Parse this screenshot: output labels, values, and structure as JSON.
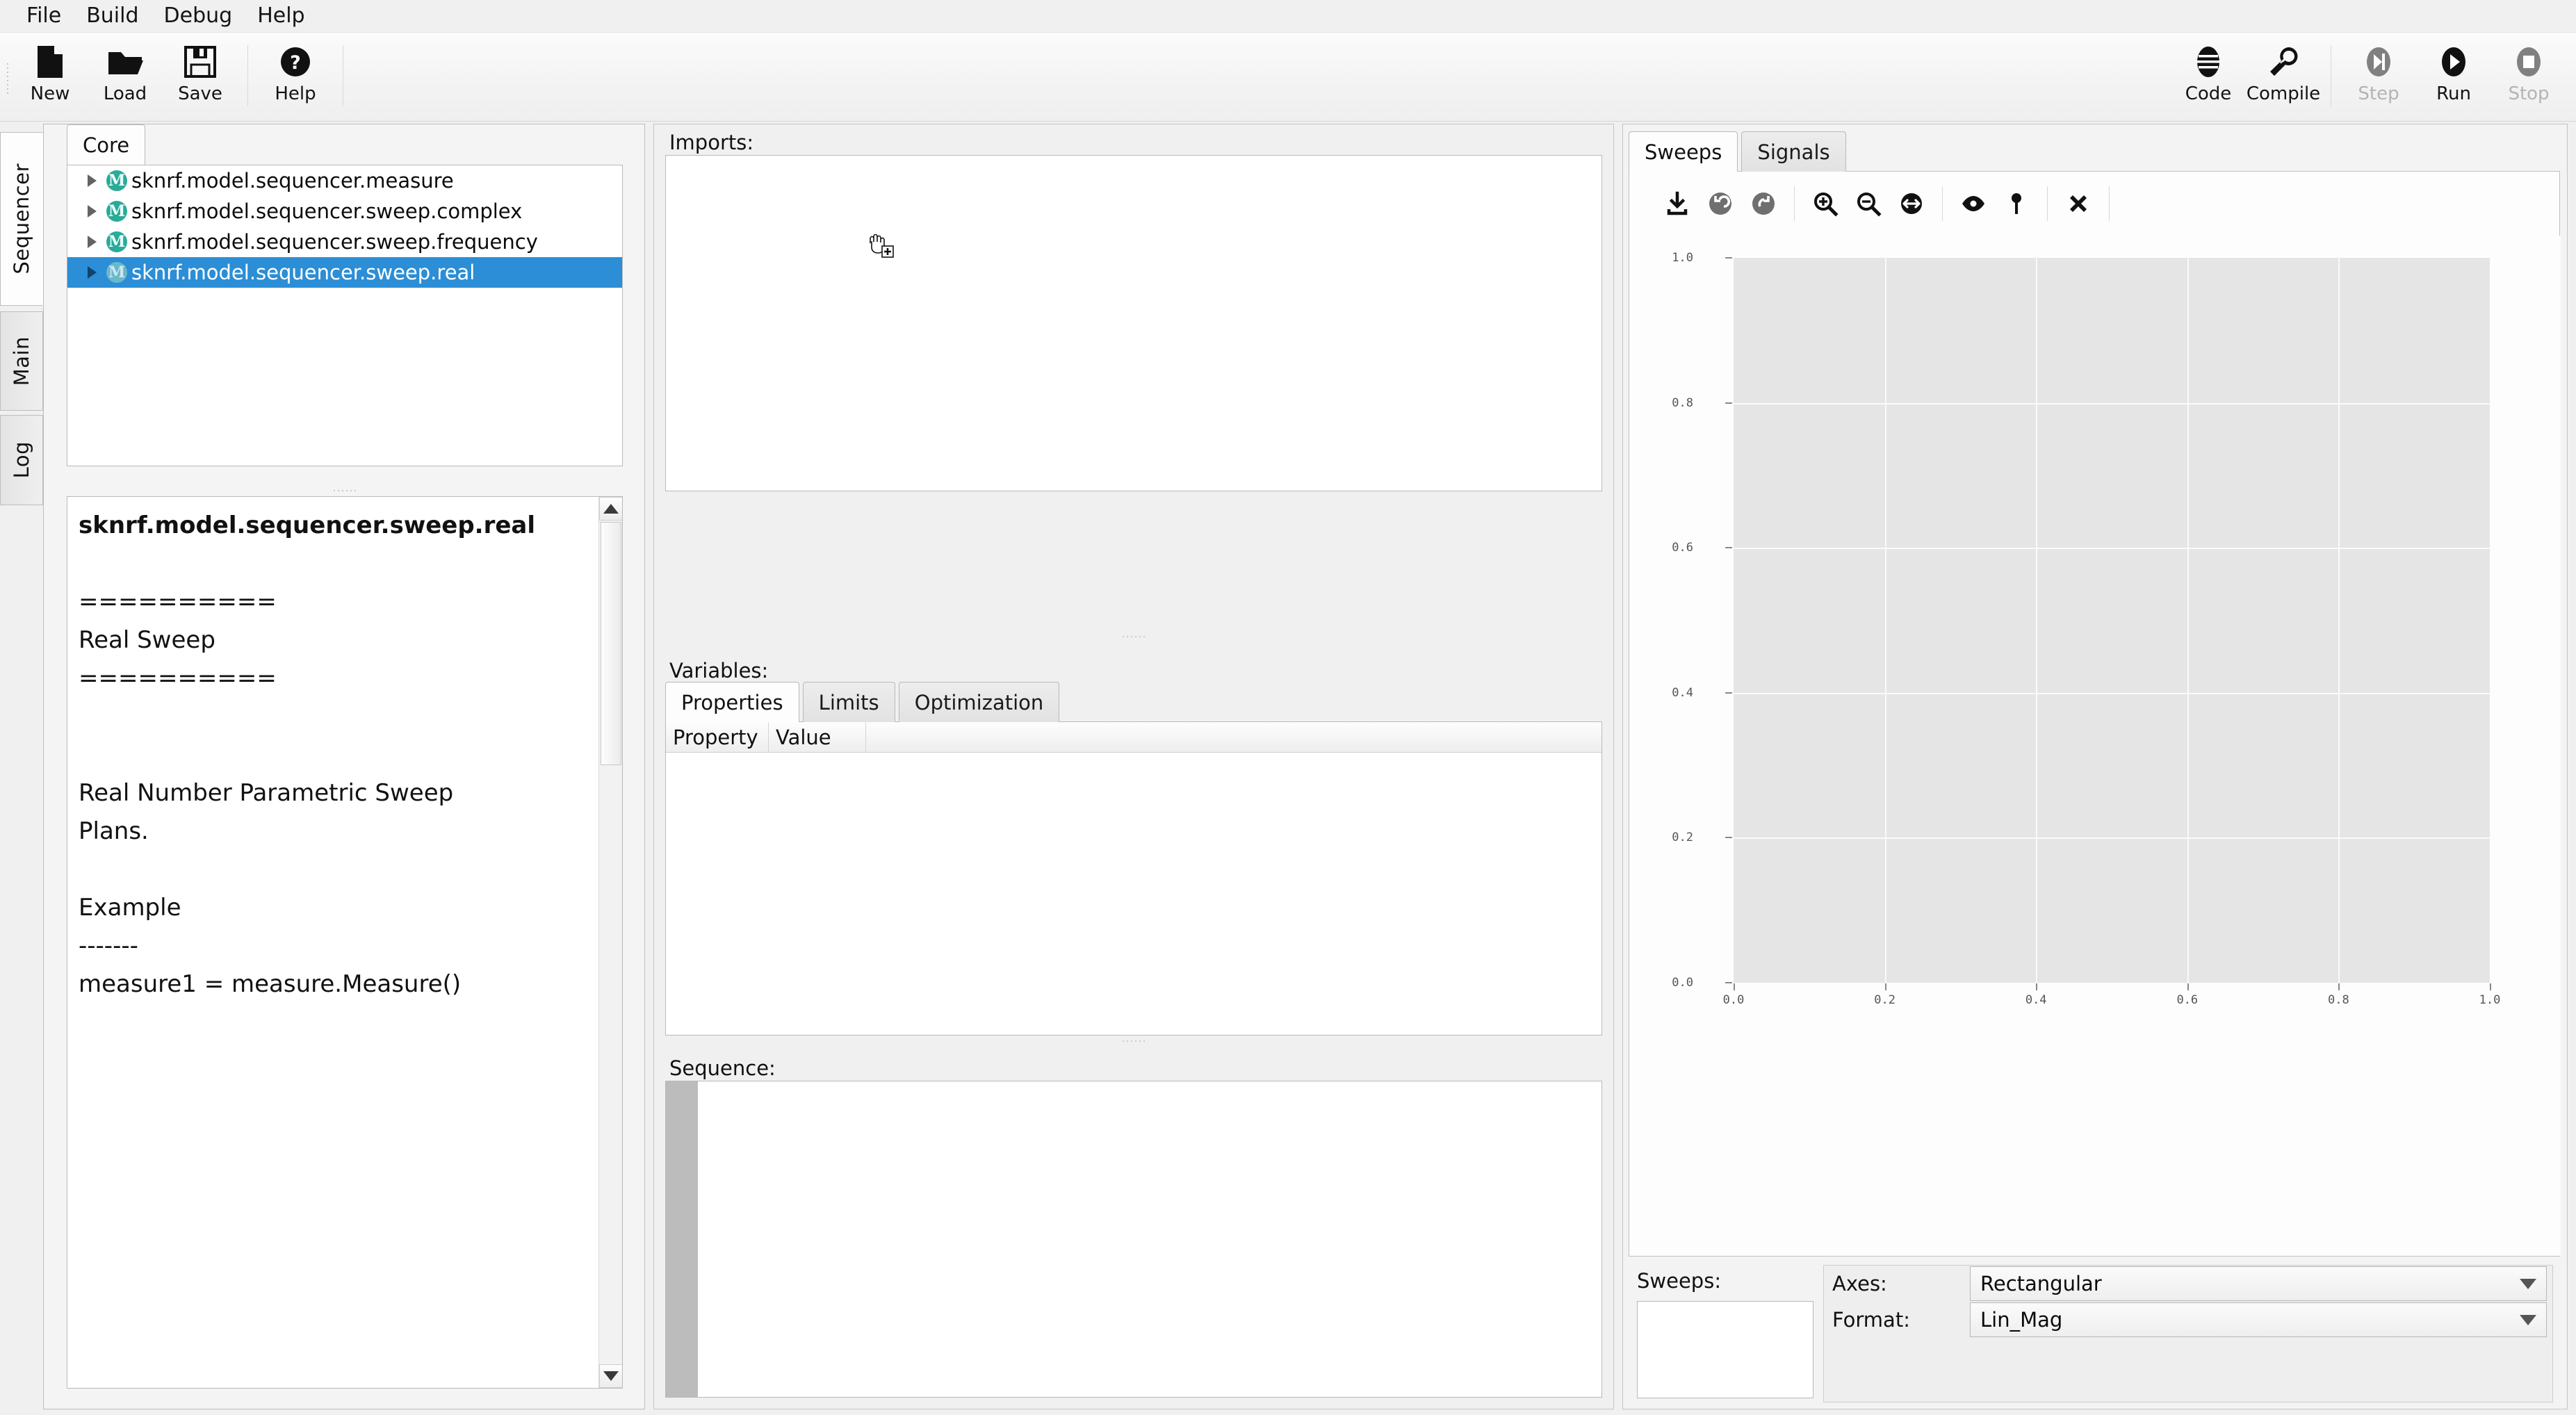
{
  "menubar": {
    "items": [
      {
        "label": "File"
      },
      {
        "label": "Build"
      },
      {
        "label": "Debug"
      },
      {
        "label": "Help"
      }
    ]
  },
  "toolbar": {
    "left_buttons": [
      {
        "label": "New",
        "icon": "new-file-icon",
        "enabled": true
      },
      {
        "label": "Load",
        "icon": "open-folder-icon",
        "enabled": true
      },
      {
        "label": "Save",
        "icon": "floppy-disk-icon",
        "enabled": true
      }
    ],
    "help_buttons": [
      {
        "label": "Help",
        "icon": "question-circle-icon",
        "enabled": true
      }
    ],
    "right_buttons": [
      {
        "label": "Code",
        "icon": "code-lines-icon",
        "enabled": true
      },
      {
        "label": "Compile",
        "icon": "wrench-icon",
        "enabled": true
      }
    ],
    "run_buttons": [
      {
        "label": "Step",
        "icon": "step-icon",
        "enabled": false
      },
      {
        "label": "Run",
        "icon": "play-icon",
        "enabled": true
      },
      {
        "label": "Stop",
        "icon": "stop-icon",
        "enabled": false
      }
    ]
  },
  "side_tabs": [
    {
      "label": "Sequencer",
      "active": true
    },
    {
      "label": "Main",
      "active": false
    },
    {
      "label": "Log",
      "active": false
    }
  ],
  "sequencer": {
    "tabs": [
      {
        "label": "Core",
        "active": true
      }
    ],
    "tree": [
      {
        "label": "sknrf.model.sequencer.measure",
        "icon": "module-m-icon",
        "selected": false
      },
      {
        "label": "sknrf.model.sequencer.sweep.complex",
        "icon": "module-m-icon",
        "selected": false
      },
      {
        "label": "sknrf.model.sequencer.sweep.frequency",
        "icon": "module-m-icon",
        "selected": false
      },
      {
        "label": "sknrf.model.sequencer.sweep.real",
        "icon": "module-m-icon",
        "selected": true
      }
    ],
    "doc_title": "sknrf.model.sequencer.sweep.real",
    "doc_body": "\n\n==========\nReal Sweep\n==========\n\n\nReal Number Parametric Sweep\nPlans.\n\nExample\n-------\nmeasure1 = measure.Measure()"
  },
  "center": {
    "imports_label": "Imports:",
    "imports_content": "",
    "variables_label": "Variables:",
    "variables_tabs": [
      {
        "label": "Properties",
        "active": true
      },
      {
        "label": "Limits",
        "active": false
      },
      {
        "label": "Optimization",
        "active": false
      }
    ],
    "variables_columns": [
      "Property",
      "Value"
    ],
    "variables_rows": [],
    "sequence_label": "Sequence:",
    "sequence_content": ""
  },
  "plot_panel": {
    "tabs": [
      {
        "label": "Sweeps",
        "active": true
      },
      {
        "label": "Signals",
        "active": false
      }
    ],
    "toolbar_icons": [
      {
        "name": "save-download-icon",
        "enabled": true
      },
      {
        "name": "undo-icon",
        "enabled": false
      },
      {
        "name": "redo-icon",
        "enabled": false
      },
      {
        "name": "zoom-in-icon",
        "enabled": true
      },
      {
        "name": "zoom-out-icon",
        "enabled": true
      },
      {
        "name": "autoscale-arrows-icon",
        "enabled": true
      },
      {
        "name": "eye-visibility-icon",
        "enabled": true
      },
      {
        "name": "marker-pin-icon",
        "enabled": true
      },
      {
        "name": "close-x-icon",
        "enabled": true
      }
    ],
    "sweeps_label": "Sweeps:",
    "sweeps_list": [],
    "axes_label": "Axes:",
    "axes_value": "Rectangular",
    "format_label": "Format:",
    "format_value": "Lin_Mag"
  },
  "chart_data": {
    "type": "line",
    "title": "",
    "xlabel": "",
    "ylabel": "",
    "series": [],
    "x_ticks": [
      "0.0",
      "0.2",
      "0.4",
      "0.6",
      "0.8",
      "1.0"
    ],
    "y_ticks": [
      "0.0",
      "0.2",
      "0.4",
      "0.6",
      "0.8",
      "1.0"
    ],
    "xlim": [
      0.0,
      1.0
    ],
    "ylim": [
      0.0,
      1.0
    ],
    "grid": true,
    "legend": "none",
    "plot_bg": "#e5e5e5",
    "grid_color": "#fafafa",
    "figure_bg": "#fdfdfd"
  },
  "colors": {
    "selection_blue": "#2b8ed6",
    "module_badge_teal": "#2caa99",
    "window_bg": "#f0f0f0"
  }
}
